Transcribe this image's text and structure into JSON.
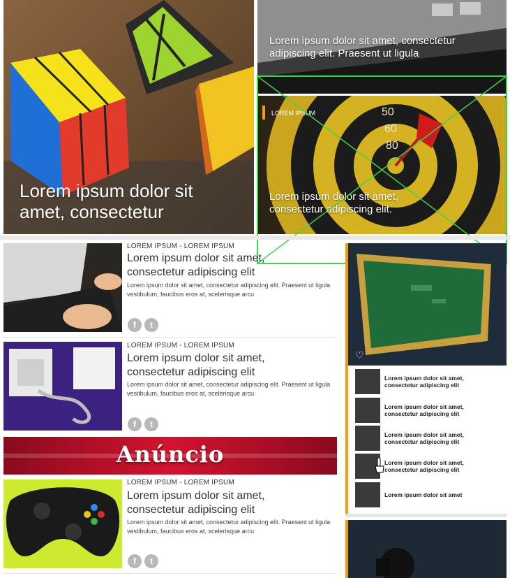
{
  "hero": {
    "title": "Lorem ipsum dolor sit amet, consectetur"
  },
  "top_right": {
    "caption": "Lorem ipsum dolor sit amet, consectetur adipiscing elit. Praesent ut ligula"
  },
  "mid_right": {
    "tag": "LOREM IPSUM",
    "caption": "Lorem ipsum dolor sit amet, consectetur adipiscing elit.",
    "dart_numbers": [
      "50",
      "60",
      "80"
    ]
  },
  "articles": [
    {
      "kicker": "LOREM IPSUM - LOREM IPSUM",
      "title": "Lorem ipsum dolor sit amet, consectetur adipiscing elit",
      "desc": "Lorem ipsum dolor sit amet, consectetur adipiscing elit. Praesent ut ligula vestibulum, faucibus eros at, scelerisque arcu"
    },
    {
      "kicker": "LOREM IPSUM - LOREM IPSUM",
      "title": "Lorem ipsum dolor sit amet, consectetur adipiscing elit",
      "desc": "Lorem ipsum dolor sit amet, consectetur adipiscing elit. Praesent ut ligula vestibulum, faucibus eros at, scelerisque arcu"
    },
    {
      "kicker": "LOREM IPSUM - LOREM IPSUM",
      "title": "Lorem ipsum dolor sit amet, consectetur adipiscing elit",
      "desc": "Lorem ipsum dolor sit amet, consectetur adipiscing elit. Praesent ut ligula vestibulum, faucibus eros at, scelerisque arcu"
    }
  ],
  "ad": {
    "label": "Anúncio"
  },
  "social": {
    "facebook": "f",
    "twitter": "t"
  },
  "sidebar": {
    "items": [
      {
        "text": "Lorem ipsum dolor sit amet, consectetur adipiscing elit"
      },
      {
        "text": "Lorem ipsum dolor sit amet, consectetur adipiscing elit"
      },
      {
        "text": "Lorem ipsum dolor sit amet, consectetur adipiscing elit"
      },
      {
        "text": "Lorem ipsum dolor sit amet, consectetur adipiscing elit"
      },
      {
        "text": "Lorem ipsum dolor sit amet"
      }
    ]
  },
  "colors": {
    "accent": "#f39c12",
    "ad_red": "#c8102e",
    "placeholder_green": "#3fd44a",
    "dark_panel": "#1d2a38"
  },
  "icons": [
    "heart-icon",
    "facebook-icon",
    "twitter-icon",
    "cursor-hand-icon"
  ]
}
